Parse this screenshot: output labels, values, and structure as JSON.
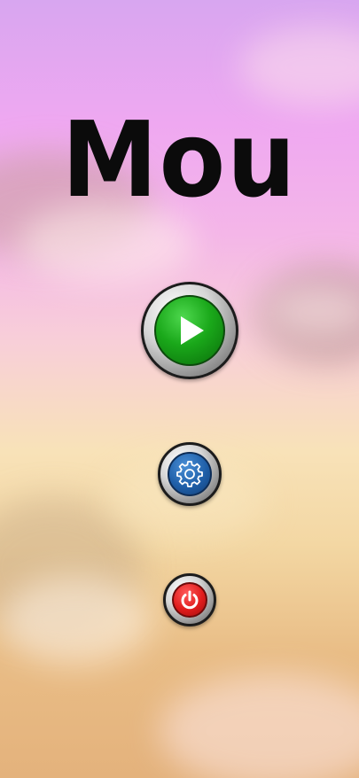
{
  "title": "Mou",
  "buttons": {
    "play": {
      "icon": "play-icon",
      "color": "#1aa81a"
    },
    "settings": {
      "icon": "gear-icon",
      "color": "#1f5fa8"
    },
    "quit": {
      "icon": "power-icon",
      "color": "#e01c1c"
    }
  },
  "background": {
    "top_color": "#d8a6f0",
    "middle_color": "#f8e2b8",
    "bottom_color": "#e4b27c"
  }
}
